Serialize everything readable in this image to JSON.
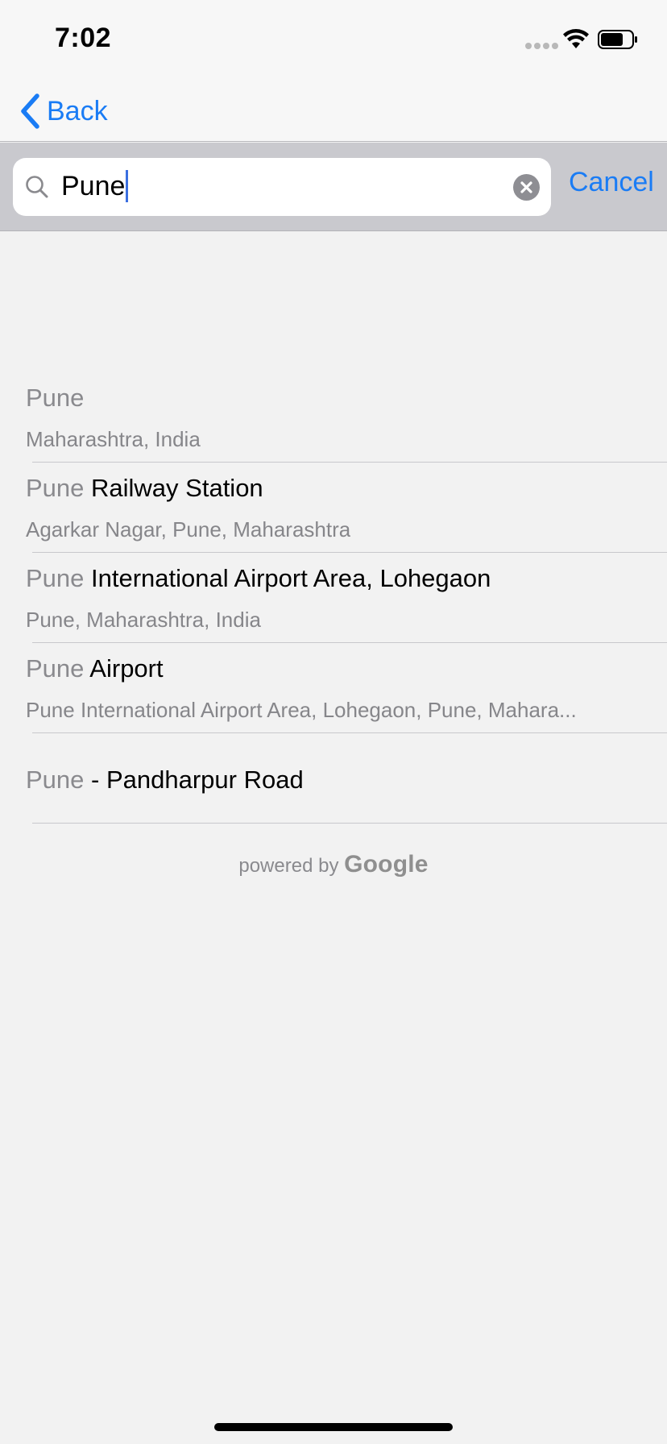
{
  "status_bar": {
    "time": "7:02",
    "icons": [
      "signal-icon",
      "wifi-icon",
      "battery-icon"
    ]
  },
  "nav": {
    "back_label": "Back",
    "back_icon": "chevron-left-icon",
    "accent_color": "#1a7cf5"
  },
  "search": {
    "value": "Pune",
    "search_icon": "search-icon",
    "clear_icon": "clear-icon",
    "cancel_label": "Cancel"
  },
  "results": [
    {
      "match": "Pune",
      "rest": "",
      "subtitle": "Maharashtra, India"
    },
    {
      "match": "Pune",
      "rest": " Railway Station",
      "subtitle": "Agarkar Nagar, Pune, Maharashtra"
    },
    {
      "match": "Pune",
      "rest": " International Airport Area, Lohegaon",
      "subtitle": "Pune, Maharashtra, India"
    },
    {
      "match": "Pune",
      "rest": " Airport",
      "subtitle": "Pune International Airport Area, Lohegaon, Pune, Mahara..."
    },
    {
      "match": "Pune",
      "rest": " - Pandharpur Road",
      "subtitle": ""
    }
  ],
  "footer": {
    "powered_by": "powered by",
    "brand": "Google"
  }
}
